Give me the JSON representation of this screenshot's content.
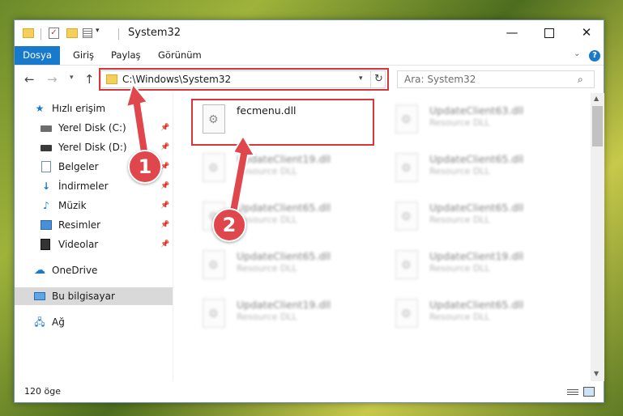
{
  "window": {
    "title": "System32",
    "minimize": "—",
    "close": "✕"
  },
  "ribbon": {
    "tabs": [
      "Dosya",
      "Giriş",
      "Paylaş",
      "Görünüm"
    ],
    "help": "?",
    "chevron": "⌄"
  },
  "nav": {
    "back": "←",
    "forward": "→",
    "recent": "⌄",
    "up": "↑",
    "address": "C:\\Windows\\System32",
    "dropdown": "⌄",
    "refresh": "↻",
    "search_placeholder": "Ara: System32",
    "search_icon": "⚲"
  },
  "sidebar": {
    "items": [
      {
        "label": "Hızlı erişim",
        "icon": "star-icon"
      },
      {
        "label": "Yerel Disk (C:)",
        "icon": "disk-icon",
        "pinned": true
      },
      {
        "label": "Yerel Disk (D:)",
        "icon": "disk-icon",
        "pinned": true
      },
      {
        "label": "Belgeler",
        "icon": "documents-icon",
        "pinned": true
      },
      {
        "label": "İndirmeler",
        "icon": "download-icon",
        "pinned": true
      },
      {
        "label": "Müzik",
        "icon": "music-icon",
        "pinned": true
      },
      {
        "label": "Resimler",
        "icon": "pictures-icon",
        "pinned": true
      },
      {
        "label": "Videolar",
        "icon": "videos-icon",
        "pinned": true
      },
      {
        "label": "OneDrive",
        "icon": "cloud-icon"
      },
      {
        "label": "Bu bilgisayar",
        "icon": "computer-icon",
        "selected": true
      },
      {
        "label": "Ağ",
        "icon": "network-icon"
      }
    ],
    "pin_glyph": "📌"
  },
  "files": [
    {
      "name": "fecmenu.dll",
      "type": ""
    },
    {
      "name": "UpdateClient63.dll",
      "type": "Resource DLL"
    },
    {
      "name": "UpdateClient19.dll",
      "type": "Resource DLL"
    },
    {
      "name": "UpdateClient65.dll",
      "type": "Resource DLL"
    },
    {
      "name": "UpdateClient65.dll",
      "type": "Resource DLL"
    },
    {
      "name": "UpdateClient65.dll",
      "type": "Resource DLL"
    },
    {
      "name": "UpdateClient65.dll",
      "type": "Resource DLL"
    },
    {
      "name": "UpdateClient19.dll",
      "type": "Resource DLL"
    },
    {
      "name": "UpdateClient19.dll",
      "type": "Resource DLL"
    },
    {
      "name": "UpdateClient65.dll",
      "type": "Resource DLL"
    }
  ],
  "status": {
    "item_count": "120 öge"
  },
  "callouts": {
    "one": "1",
    "two": "2"
  },
  "colors": {
    "accent": "#1979ca",
    "highlight": "#d7373b",
    "badge": "#e0474c"
  }
}
